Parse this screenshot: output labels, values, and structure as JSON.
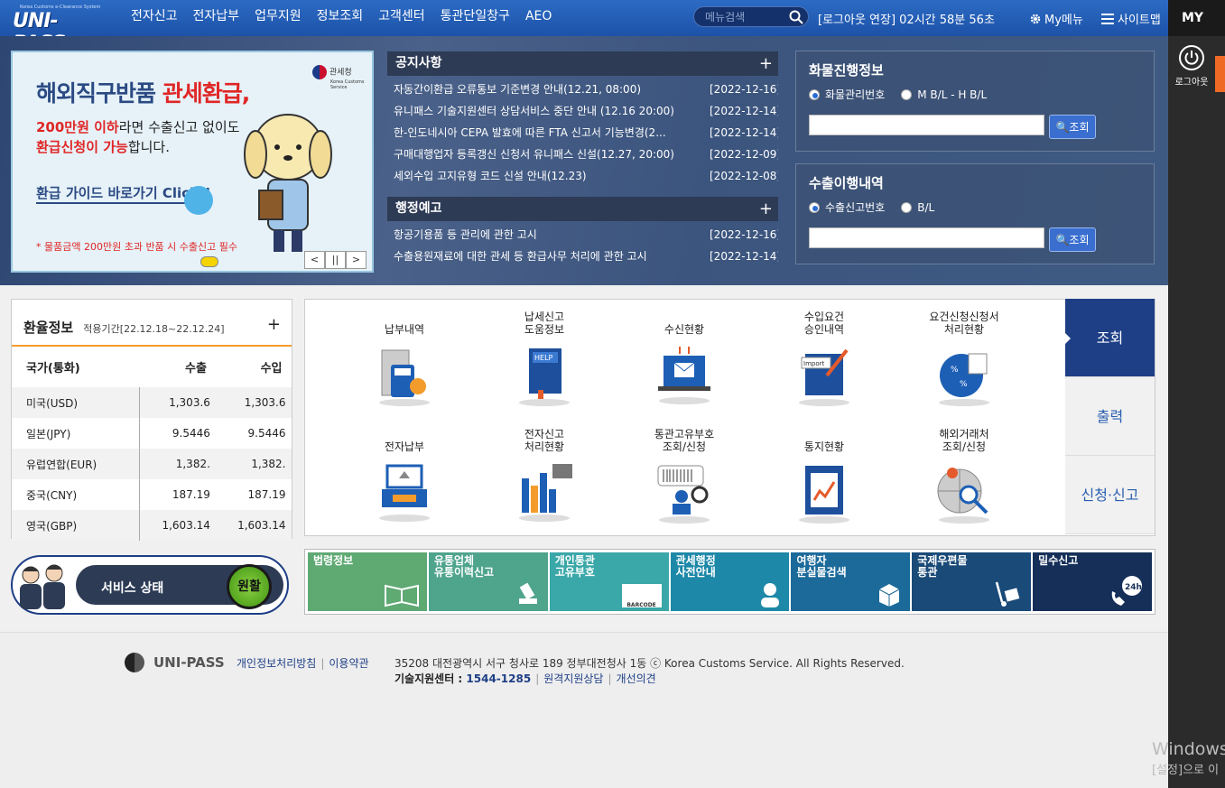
{
  "header": {
    "logo_small": "Korea Customs e-Clearance System",
    "logo": "UNI-PASS",
    "nav": [
      "전자신고",
      "전자납부",
      "업무지원",
      "정보조회",
      "고객센터",
      "통관단일창구",
      "AEO"
    ],
    "search_placeholder": "메뉴검색",
    "logout_info": "[로그아웃 연장] 02시간 58분 56초",
    "my_menu": "My메뉴",
    "sitemap": "사이트맵"
  },
  "rightbar": {
    "my": "MY",
    "logout": "로그아웃"
  },
  "banner": {
    "title_a": "해외직구반품 ",
    "title_b": "관세환급,",
    "line1_r": "200만원 이하",
    "line1": "라면 수출신고 없이도",
    "line2_r": "환급신청이 가능",
    "line2": "합니다.",
    "guide": "환급 가이드 바로가기 Click!!",
    "warning": "* 물품금액 200만원 초과 반품 시 수출신고 필수",
    "brand": "관세청",
    "brand_sub": "Korea Customs Service"
  },
  "notice": {
    "title": "공지사항",
    "items": [
      {
        "t": "자동간이환급 오류통보 기준변경 안내(12.21, 08:00)",
        "d": "[2022-12-16]"
      },
      {
        "t": "유니패스 기술지원센터 상담서비스 중단 안내 (12.16 20:00)",
        "d": "[2022-12-14]"
      },
      {
        "t": "한-인도네시아 CEPA 발효에 따른 FTA 신고서 기능변경(2...",
        "d": "[2022-12-14]"
      },
      {
        "t": "구매대행업자 등록갱신 신청서 유니패스 신설(12.27, 20:00)",
        "d": "[2022-12-09]"
      },
      {
        "t": "세외수입 고지유형 코드 신설 안내(12.23)",
        "d": "[2022-12-08]"
      }
    ]
  },
  "admin": {
    "title": "행정예고",
    "items": [
      {
        "t": "항공기용품 등 관리에 관한 고시",
        "d": "[2022-12-16]"
      },
      {
        "t": "수출용원재료에 대한 관세 등 환급사무 처리에 관한 고시",
        "d": "[2022-12-14]"
      }
    ]
  },
  "cargo": {
    "title": "화물진행정보",
    "opt1": "화물관리번호",
    "opt2": "M B/L - H B/L",
    "btn": "조회"
  },
  "export": {
    "title": "수출이행내역",
    "opt1": "수출신고번호",
    "opt2": "B/L",
    "btn": "조회"
  },
  "exchange": {
    "title": "환율정보",
    "period": "적용기간[22.12.18~22.12.24]",
    "cols": [
      "국가(통화)",
      "수출",
      "수입"
    ],
    "rows": [
      [
        "미국(USD)",
        "1,303.6",
        "1,303.6"
      ],
      [
        "일본(JPY)",
        "9.5446",
        "9.5446"
      ],
      [
        "유럽연합(EUR)",
        "1,382.",
        "1,382."
      ],
      [
        "중국(CNY)",
        "187.19",
        "187.19"
      ],
      [
        "영국(GBP)",
        "1,603.14",
        "1,603.14"
      ]
    ]
  },
  "quick": [
    {
      "l1": "납부내역",
      "l2": ""
    },
    {
      "l1": "납세신고",
      "l2": "도움정보"
    },
    {
      "l1": "수신현황",
      "l2": ""
    },
    {
      "l1": "수입요건",
      "l2": "승인내역"
    },
    {
      "l1": "요건신청신청서",
      "l2": "처리현황"
    },
    {
      "l1": "전자납부",
      "l2": ""
    },
    {
      "l1": "전자신고",
      "l2": "처리현황"
    },
    {
      "l1": "통관고유부호",
      "l2": "조회/신청"
    },
    {
      "l1": "통지현황",
      "l2": ""
    },
    {
      "l1": "해외거래처",
      "l2": "조회/신청"
    }
  ],
  "qtabs": [
    "조회",
    "출력",
    "신청·신고"
  ],
  "service": {
    "label": "서비스 상태",
    "status": "원활"
  },
  "tiles": [
    {
      "l1": "법령정보",
      "l2": "",
      "color": "#5fa973"
    },
    {
      "l1": "유통업체",
      "l2": "유통이력신고",
      "color": "#4fa48c"
    },
    {
      "l1": "개인통관",
      "l2": "고유부호",
      "color": "#3aa7a8",
      "barcode": "BARCODE"
    },
    {
      "l1": "관세행정",
      "l2": "사전안내",
      "color": "#1e88a8"
    },
    {
      "l1": "여행자",
      "l2": "분실물검색",
      "color": "#1c6a9a"
    },
    {
      "l1": "국제우편물",
      "l2": "통관",
      "color": "#1a4a78"
    },
    {
      "l1": "밀수신고",
      "l2": "",
      "color": "#152f58",
      "badge": "24h"
    }
  ],
  "footer": {
    "logo": "UNI-PASS",
    "privacy": "개인정보처리방침",
    "terms": "이용약관",
    "address": "35208 대전광역시 서구 청사로 189 정부대전청사 1동 ⓒ Korea Customs Service. All Rights Reserved.",
    "tech_label": "기술지원센터 : ",
    "tech_phone": "1544-1285",
    "remote": "원격지원상담",
    "opinion": "개선의견"
  },
  "watermark": {
    "l1": "Windows",
    "l2": "[설정]으로 이"
  }
}
